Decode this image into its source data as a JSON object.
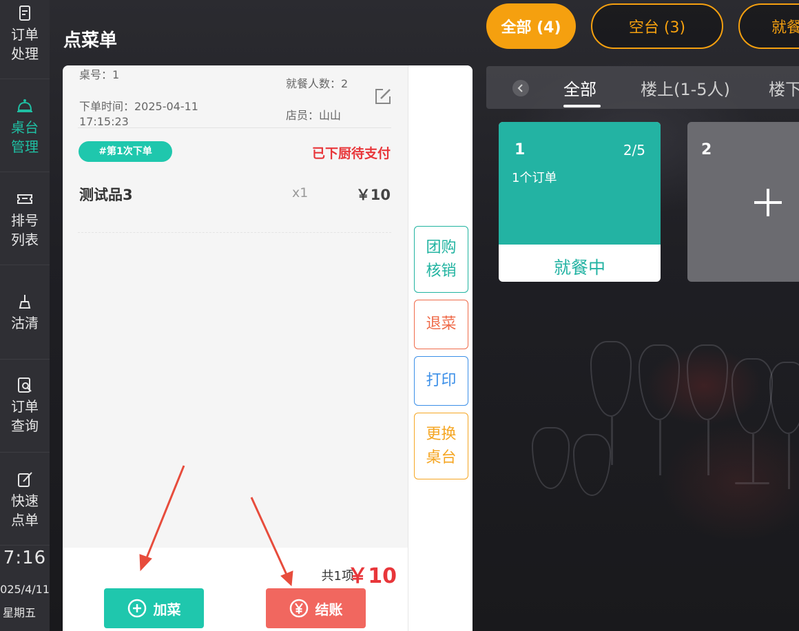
{
  "sidebar": {
    "items": [
      {
        "label": "订单处理",
        "icon": "order-icon"
      },
      {
        "label": "桌台管理",
        "icon": "table-service-icon"
      },
      {
        "label": "排号列表",
        "icon": "ticket-icon"
      },
      {
        "label": "沽清",
        "icon": "broom-icon"
      },
      {
        "label": "订单查询",
        "icon": "order-search-icon"
      },
      {
        "label": "快速点单",
        "icon": "quick-order-icon"
      }
    ],
    "time": "7:16",
    "date": "025/4/11",
    "weekday": "星期五"
  },
  "panel": {
    "title": "点菜单",
    "table_no": "桌号：1",
    "diners": "就餐人数：2",
    "order_time": "下单时间：2025-04-11",
    "order_time2": "17:15:23",
    "staff": "店员：山山",
    "batch_tag": "#第1次下单",
    "status": "已下厨待支付",
    "items": [
      {
        "name": "测试品3",
        "qty": "x1",
        "price": "￥10"
      }
    ],
    "total_label": "共1项",
    "total_value": "￥10",
    "add_button": "加菜",
    "pay_button": "结账"
  },
  "side_actions": {
    "group_verify": "团购核销",
    "return_dish": "退菜",
    "print": "打印",
    "change_table": "更换桌台"
  },
  "filters": {
    "all": "全部 (4)",
    "empty": "空台 (3)",
    "dining": "就餐"
  },
  "area_tabs": {
    "all": "全部",
    "upstairs": "楼上(1-5人)",
    "downstairs": "楼下"
  },
  "tables": [
    {
      "number": "1",
      "seats": "2/5",
      "orders": "1个订单",
      "state": "就餐中",
      "color": "#23b3a3"
    },
    {
      "number": "2",
      "color": "#6b6b70"
    }
  ],
  "colors": {
    "accent_green": "#1fc7ad",
    "accent_orange": "#f5a00f",
    "alert_red": "#e8363a",
    "annotation_arrow": "#e74c3c"
  }
}
